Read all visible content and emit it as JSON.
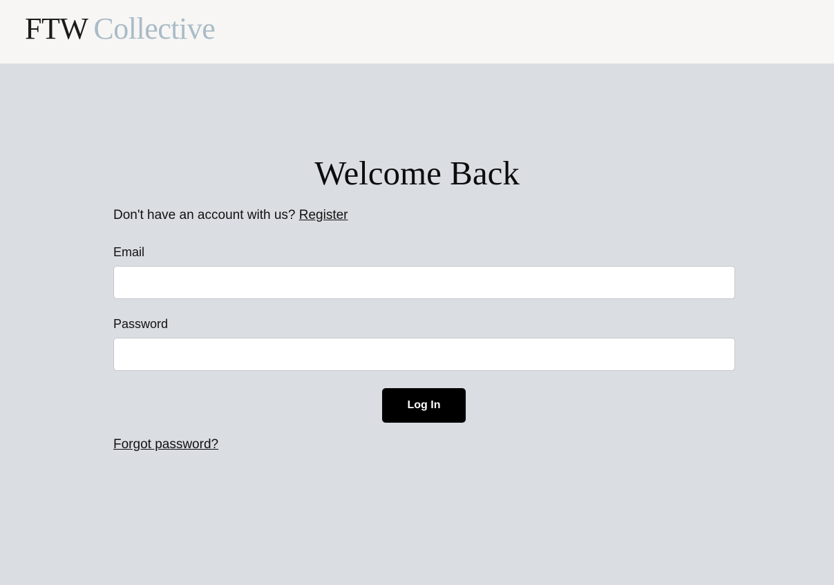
{
  "header": {
    "logo_primary": "FTW",
    "logo_secondary": "Collective",
    "colors": {
      "background": "#f7f6f4",
      "logo_primary": "#1b1b1b",
      "logo_secondary": "#a9bbc7"
    }
  },
  "login": {
    "title": "Welcome Back",
    "register_prompt": "Don't have an account with us?",
    "register_link": "Register",
    "email_label": "Email",
    "email_value": "",
    "password_label": "Password",
    "password_value": "",
    "submit_label": "Log In",
    "forgot_link": "Forgot password?",
    "colors": {
      "background": "#dadde2",
      "button": "#000000",
      "button_text": "#ffffff"
    }
  }
}
